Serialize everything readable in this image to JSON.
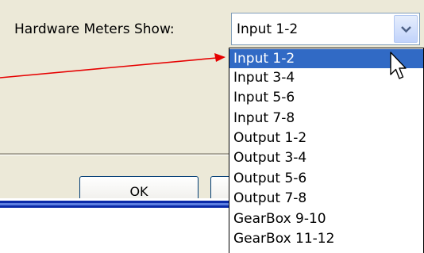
{
  "dialog": {
    "label": "Hardware Meters Show:",
    "ok_label": "OK"
  },
  "combo": {
    "value": "Input 1-2",
    "button_icon": "chevron-down-icon"
  },
  "dropdown": {
    "selected_index": 0,
    "options": [
      "Input 1-2",
      "Input 3-4",
      "Input 5-6",
      "Input 7-8",
      "Output 1-2",
      "Output 3-4",
      "Output 5-6",
      "Output 7-8",
      "GearBox 9-10",
      "GearBox 11-12"
    ]
  },
  "colors": {
    "dialog_bg": "#ece9d8",
    "selection": "#316ac5",
    "annotation_arrow": "#e60000"
  },
  "icons": [
    "chevron-down-icon",
    "mouse-pointer-icon",
    "annotation-arrow-icon"
  ]
}
